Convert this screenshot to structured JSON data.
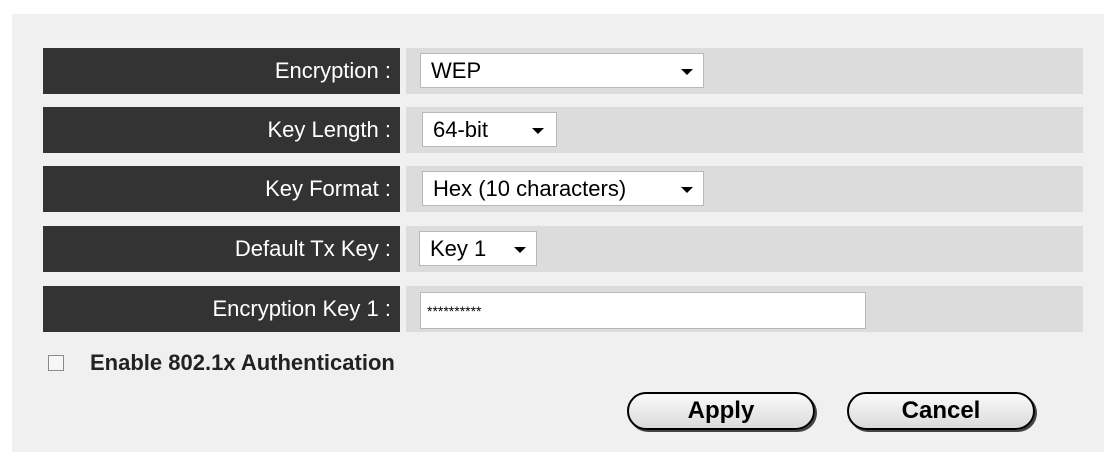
{
  "form": {
    "encryption": {
      "label": "Encryption :",
      "value": "WEP"
    },
    "key_length": {
      "label": "Key Length :",
      "value": "64-bit"
    },
    "key_format": {
      "label": "Key Format :",
      "value": "Hex (10 characters)"
    },
    "default_tx_key": {
      "label": "Default Tx Key :",
      "value": "Key 1"
    },
    "encryption_key_1": {
      "label": "Encryption Key 1 :",
      "value": "**********"
    }
  },
  "auth_checkbox": {
    "label": "Enable 802.1x Authentication",
    "checked": false
  },
  "buttons": {
    "apply": "Apply",
    "cancel": "Cancel"
  },
  "icons": {
    "dropdown": "chevron-down-icon"
  }
}
